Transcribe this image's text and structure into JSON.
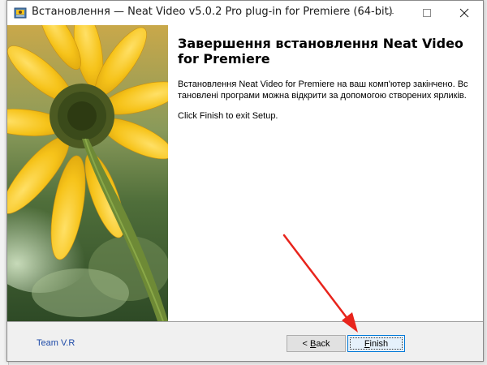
{
  "window": {
    "title": "Встановлення — Neat Video v5.0.2 Pro plug-in for Premiere (64-bit)"
  },
  "content": {
    "heading": "Завершення встановлення Neat Video for Premiere",
    "message": "Встановлення Neat Video for Premiere на ваш комп'ютер закінчено. Встановлені програми можна відкрити за допомогою створених ярликів.",
    "instruction": "Click Finish to exit Setup."
  },
  "footer": {
    "branding": "Team V.R",
    "back_prefix": "< ",
    "back_accel": "B",
    "back_rest": "ack",
    "finish_accel": "F",
    "finish_rest": "inish"
  },
  "icons": {
    "app": "installer-icon",
    "minimize": "minimize-icon",
    "maximize": "maximize-icon",
    "close": "close-icon"
  },
  "colors": {
    "accent": "#0078d7",
    "link": "#1d4aa8",
    "annotation_arrow": "#e8241c",
    "flower_petal": "#f6c31a"
  }
}
